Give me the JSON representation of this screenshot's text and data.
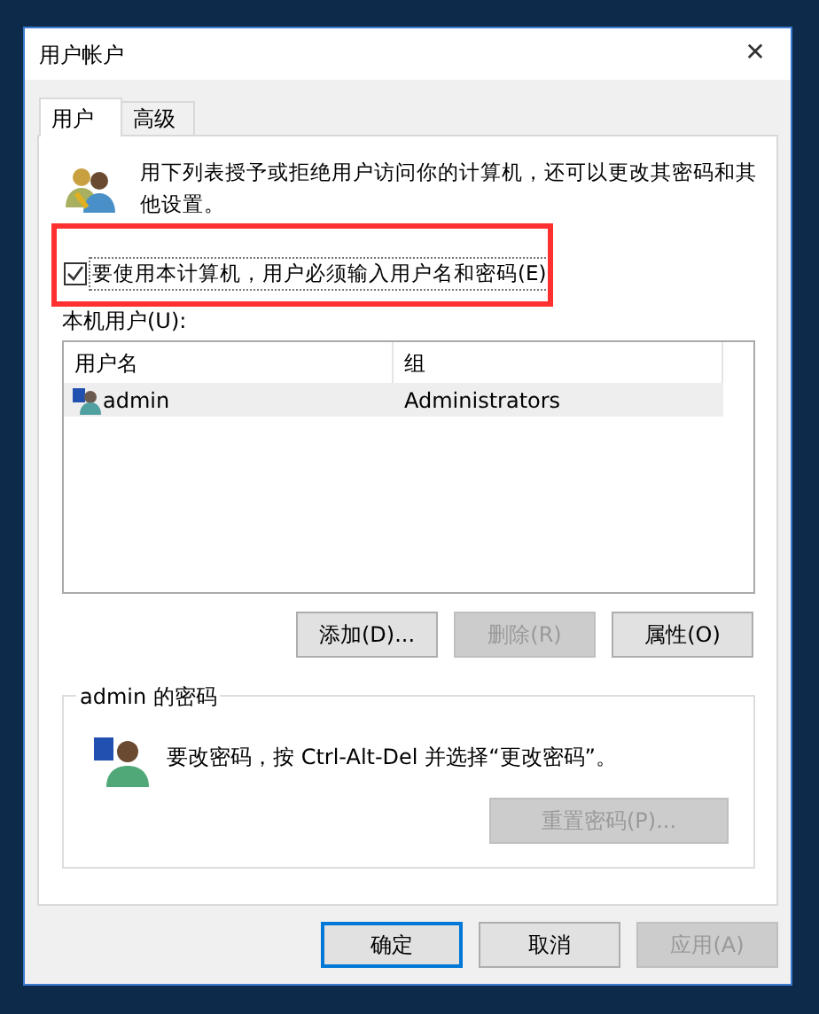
{
  "window": {
    "title": "用户帐户",
    "close": "✕"
  },
  "tabs": [
    {
      "label": "用户",
      "selected": true
    },
    {
      "label": "高级",
      "selected": false
    }
  ],
  "intro": "用下列表授予或拒绝用户访问你的计算机，还可以更改其密码和其他设置。",
  "require_password": {
    "label": "要使用本计算机，用户必须输入用户名和密码(E)",
    "checked": true
  },
  "users_label": "本机用户(U):",
  "table": {
    "columns": [
      "用户名",
      "组"
    ],
    "rows": [
      {
        "cells": [
          "admin",
          "Administrators"
        ],
        "selected": true
      }
    ]
  },
  "user_buttons": [
    {
      "label": "添加(D)...",
      "disabled": false
    },
    {
      "label": "删除(R)",
      "disabled": true
    },
    {
      "label": "属性(O)",
      "disabled": false
    }
  ],
  "password_group": {
    "title": "admin 的密码",
    "message": "要改密码，按 Ctrl-Alt-Del 并选择“更改密码”。",
    "button": {
      "label": "重置密码(P)...",
      "disabled": true
    }
  },
  "dialog_buttons": [
    {
      "label": "确定",
      "disabled": false,
      "default": true
    },
    {
      "label": "取消",
      "disabled": false,
      "default": false
    },
    {
      "label": "应用(A)",
      "disabled": true,
      "default": false
    }
  ]
}
